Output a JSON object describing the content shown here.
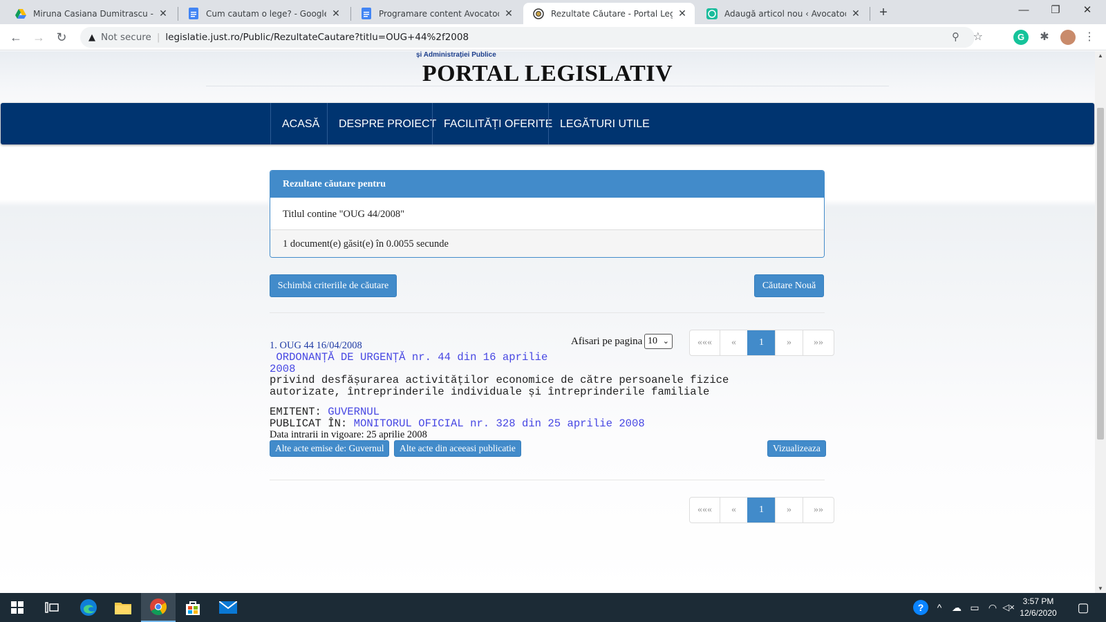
{
  "browser": {
    "tabs": [
      {
        "title": "Miruna Casiana Dumitrascu - Goo",
        "favicon": "google-drive-icon"
      },
      {
        "title": "Cum cautam o lege? - Google Do",
        "favicon": "google-docs-icon"
      },
      {
        "title": "Programare content Avocatoo.do",
        "favicon": "google-docs-icon"
      },
      {
        "title": "Rezultate Căutare - Portal Legisla",
        "favicon": "portal-crest-icon"
      },
      {
        "title": "Adaugă articol nou ‹ Avocatoo —",
        "favicon": "wordpress-icon"
      }
    ],
    "active_tab": 3,
    "security_label": "Not secure",
    "url": "legislatie.just.ro/Public/RezultateCautare?titlu=OUG+44%2f2008"
  },
  "site": {
    "ministry_text": "și Administrației Publice",
    "title": "PORTAL LEGISLATIV",
    "nav": [
      "ACASĂ",
      "DESPRE PROIECT",
      "FACILITĂȚI OFERITE",
      "LEGĂTURI UTILE"
    ]
  },
  "search_panel": {
    "heading": "Rezultate căutare pentru",
    "criteria": "Titlul contine \"OUG 44/2008\"",
    "summary": "1 document(e) găsit(e) în 0.0055 secunde"
  },
  "buttons": {
    "change_criteria": "Schimbă criteriile de căutare",
    "new_search": "Căutare Nouă",
    "other_by_issuer": "Alte acte emise de: Guvernul",
    "other_same_publication": "Alte acte din aceeasi publicatie",
    "view": "Vizualizeaza"
  },
  "pagination": {
    "per_page_label": "Afisari pe pagina",
    "per_page_value": "10",
    "first": "«««",
    "prev": "«",
    "current": "1",
    "next": "»",
    "last": "»»"
  },
  "result": {
    "number_line": "1. OUG 44 16/04/2008",
    "title_line1": " ORDONANȚĂ DE URGENȚĂ nr. 44 din 16 aprilie",
    "title_line2": "2008",
    "desc_line1": "privind desfășurarea activităților economice de către persoanele fizice",
    "desc_line2": "autorizate, întreprinderile individuale și întreprinderile familiale",
    "issuer_label": "EMITENT: ",
    "issuer_value": "GUVERNUL",
    "published_label": "PUBLICAT ÎN: ",
    "published_value": "MONITORUL OFICIAL nr. 328 din 25 aprilie 2008",
    "effective_date": "Data intrarii in vigoare: 25 aprilie 2008"
  },
  "taskbar": {
    "time": "3:57 PM",
    "date": "12/6/2020"
  },
  "colors": {
    "nav_bg": "#003470",
    "primary": "#428bca",
    "link_blue": "#4747e3",
    "taskbar_bg": "#1c2b36"
  }
}
